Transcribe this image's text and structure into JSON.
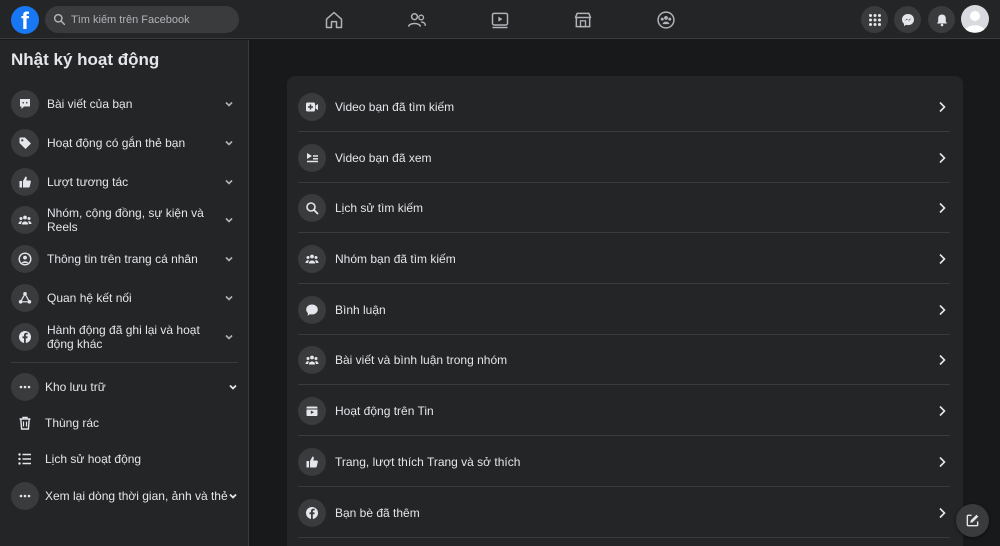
{
  "topbar": {
    "search_placeholder": "Tìm kiếm trên Facebook",
    "logo_letter": "f"
  },
  "sidebar": {
    "title": "Nhật ký hoạt động",
    "items": [
      {
        "label": "Bài viết của bạn",
        "icon": "comment-box-icon"
      },
      {
        "label": "Hoạt động có gắn thẻ bạn",
        "icon": "tag-icon"
      },
      {
        "label": "Lượt tương tác",
        "icon": "thumbs-up-icon"
      },
      {
        "label": "Nhóm, cộng đồng, sự kiện và Reels",
        "icon": "group-icon"
      },
      {
        "label": "Thông tin trên trang cá nhân",
        "icon": "profile-icon"
      },
      {
        "label": "Quan hệ kết nối",
        "icon": "connections-icon"
      },
      {
        "label": "Hành động đã ghi lại và hoạt động khác",
        "icon": "facebook-icon"
      }
    ],
    "extra": [
      {
        "label": "Kho lưu trữ",
        "icon": "more-icon"
      },
      {
        "label": "Thùng rác",
        "icon": "trash-icon"
      },
      {
        "label": "Lịch sử hoạt động",
        "icon": "list-icon"
      },
      {
        "label": "Xem lại dòng thời gian, ảnh và thẻ",
        "icon": "more-icon"
      }
    ]
  },
  "main": {
    "rows": [
      {
        "label": "Video bạn đã tìm kiếm",
        "icon": "video-search-icon"
      },
      {
        "label": "Video bạn đã xem",
        "icon": "video-watched-icon"
      },
      {
        "label": "Lịch sử tìm kiếm",
        "icon": "search-icon"
      },
      {
        "label": "Nhóm bạn đã tìm kiếm",
        "icon": "group-icon"
      },
      {
        "label": "Bình luận",
        "icon": "comment-icon"
      },
      {
        "label": "Bài viết và bình luận trong nhóm",
        "icon": "group-icon"
      },
      {
        "label": "Hoạt động trên Tin",
        "icon": "story-icon"
      },
      {
        "label": "Trang, lượt thích Trang và sở thích",
        "icon": "thumbs-up-icon"
      },
      {
        "label": "Bạn bè đã thêm",
        "icon": "facebook-icon"
      }
    ]
  },
  "colors": {
    "background": "#18191a",
    "surface": "#242526",
    "hover": "#3a3b3c",
    "brand": "#1877f2",
    "text": "#e4e6eb"
  }
}
